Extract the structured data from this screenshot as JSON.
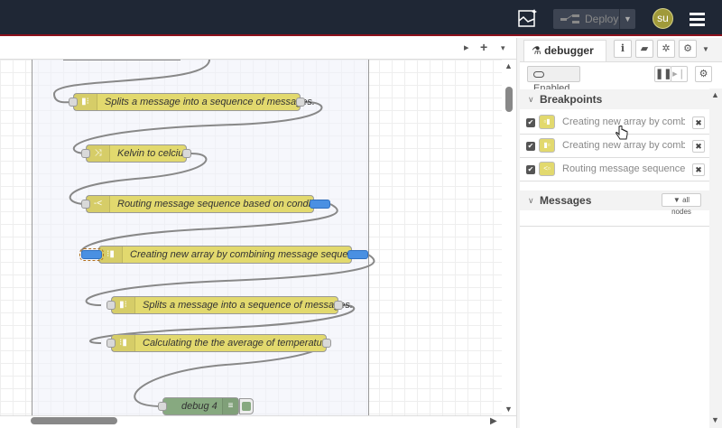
{
  "header": {
    "deploy_label": "Deploy",
    "avatar_initials": "su",
    "icons": [
      "debug-chart-icon",
      "deploy-flow-icon",
      "menu-icon"
    ]
  },
  "workspace": {
    "buttons": [
      "▸",
      "+",
      "▾"
    ]
  },
  "flow": {
    "nodes": [
      {
        "label": "Splits a message into a sequence of messages.",
        "icon": "split-icon"
      },
      {
        "label": "Kelvin to celcius",
        "icon": "change-icon"
      },
      {
        "label": "Routing message sequence based on condition",
        "icon": "switch-icon"
      },
      {
        "label": "Creating new array by combining message sequence",
        "icon": "join-icon"
      },
      {
        "label": "Splits a message into a sequence of messages.",
        "icon": "split-icon"
      },
      {
        "label": "Calculating the the average of temperature",
        "icon": "join-icon"
      },
      {
        "label": "debug 4",
        "icon": "debug-icon"
      }
    ],
    "colors": {
      "function_node": "#e2d96e",
      "debug_node": "#87a980",
      "breakpoint_port": "#4a90e2"
    }
  },
  "sidebar": {
    "tab_label": "debugger",
    "enabled_label": "Enabled",
    "breakpoints_title": "Breakpoints",
    "breakpoints": [
      {
        "label": "Creating new array by combining message sequence",
        "checked": true
      },
      {
        "label": "Creating new array by combining message sequence",
        "checked": true
      },
      {
        "label": "Routing message sequence based on condition",
        "checked": true
      }
    ],
    "messages_title": "Messages",
    "filter_label": "all nodes"
  }
}
